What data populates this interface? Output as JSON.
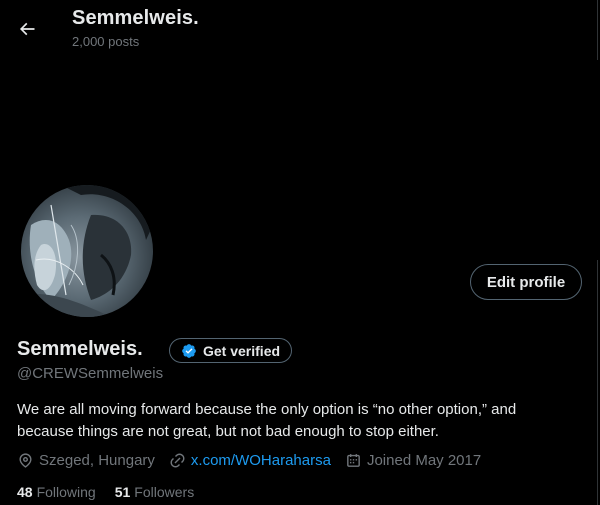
{
  "header": {
    "title": "Semmelweis.",
    "posts_count": "2,000 posts",
    "back_icon": "arrow-left-icon"
  },
  "profile": {
    "display_name": "Semmelweis.",
    "handle": "@CREWSemmelweis",
    "edit_label": "Edit profile",
    "verify_label": "Get verified",
    "bio_line1": "We are all moving forward because the only option is “no other option,” and",
    "bio_line2": "because things are not great, but not bad enough to stop either.",
    "location": "Szeged, Hungary",
    "website": "x.com/WOHaraharsa",
    "joined": "Joined May 2017",
    "following_count": "48",
    "following_label": "Following",
    "followers_count": "51",
    "followers_label": "Followers"
  },
  "icons": {
    "location": "location-pin-icon",
    "link": "link-icon",
    "calendar": "calendar-icon",
    "verified": "verified-badge-icon"
  },
  "colors": {
    "background": "#000000",
    "text_primary": "#e7e9ea",
    "text_secondary": "#71767b",
    "accent": "#1d9bf0",
    "border": "#536471"
  }
}
